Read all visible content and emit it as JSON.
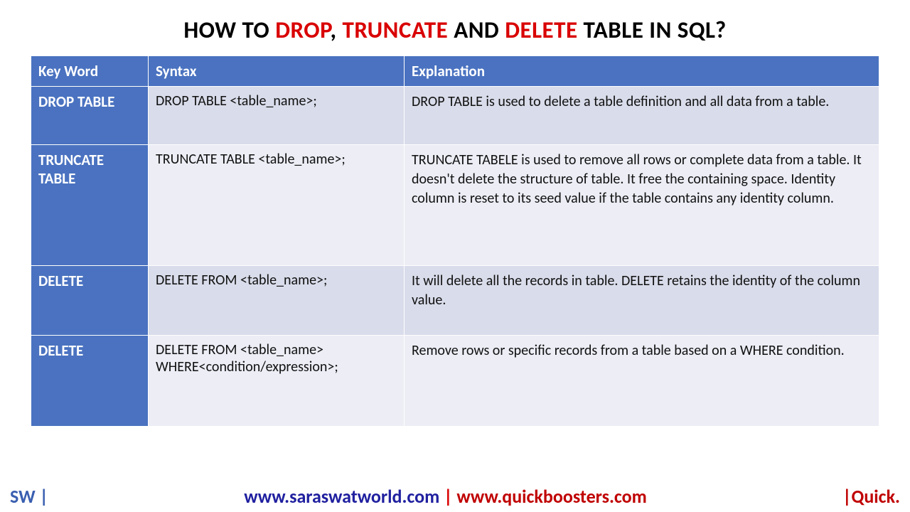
{
  "title": {
    "p1": "HOW TO ",
    "w1": "DROP",
    "sep1": ", ",
    "w2": "TRUNCATE",
    "sep2": " AND ",
    "w3": "DELETE",
    "p2": " TABLE IN SQL?"
  },
  "headers": {
    "key": "Key Word",
    "syntax": "Syntax",
    "explain": "Explanation"
  },
  "rows": [
    {
      "key": "DROP TABLE",
      "syntax": "DROP TABLE <table_name>;",
      "explain": "DROP TABLE is used to delete a table definition and all data from a table."
    },
    {
      "key": "TRUNCATE TABLE",
      "syntax": "TRUNCATE TABLE <table_name>;",
      "explain": "TRUNCATE TABELE is used to remove all rows or complete data from a table. It doesn't delete the structure of table. It free the containing space. Identity column is reset to its seed value if the table contains any identity column."
    },
    {
      "key": "DELETE",
      "syntax": "DELETE FROM <table_name>;",
      "explain": "It will delete all the records in table. DELETE retains the identity of the column value."
    },
    {
      "key": "DELETE",
      "syntax": "DELETE FROM <table_name> WHERE<condition/expression>;",
      "explain": "Remove rows or specific records from a table based on a WHERE condition."
    }
  ],
  "footer": {
    "left": "SW |",
    "url1": "www.saraswatworld.com",
    "sep": " | ",
    "url2": "www.quickboosters.com",
    "right": "|Quick."
  }
}
